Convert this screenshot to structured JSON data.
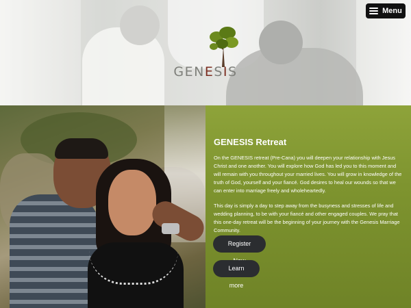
{
  "header": {
    "logo_text_left": "GEN",
    "logo_text_accent1": "E",
    "logo_text_mid": "S",
    "logo_text_accent2": "I",
    "logo_text_right": "S",
    "menu_label": "Menu"
  },
  "colors": {
    "accent_green": "#7e942f",
    "button_dark": "#2b2d30",
    "logo_accent": "#7a2c1f"
  },
  "retreat": {
    "title": "GENESIS Retreat",
    "paragraph1": "On the GENESIS retreat (Pre-Cana) you will deepen your relationship with Jesus Christ and one another. You will explore how God has led you to this moment and will remain with you throughout your married lives. You will grow in knowledge of the truth of God, yourself and your fiancé. God desires to heal our wounds so that we can enter into marriage freely and wholeheartedly.",
    "paragraph2": "This day is simply a day to step away from the busyness and stresses of life and wedding planning, to be with your fiancé and other engaged couples. We pray that this one-day retreat will be the beginning of your journey with the Genesis Marriage Community.",
    "register_label": "Register Now",
    "learn_label": "Learn more"
  },
  "icons": {
    "menu": "hamburger-icon",
    "logo": "tree-icon"
  }
}
